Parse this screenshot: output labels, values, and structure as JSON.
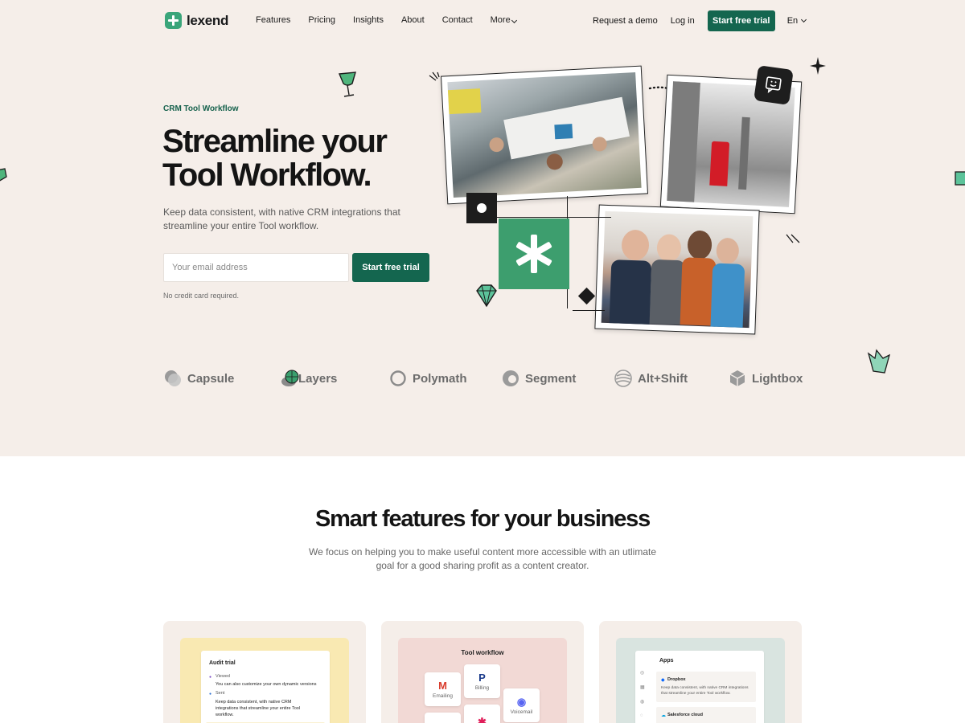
{
  "nav": {
    "logo": "lexend",
    "links": [
      "Features",
      "Pricing",
      "Insights",
      "About",
      "Contact"
    ],
    "more": "More",
    "request_demo": "Request a demo",
    "login": "Log in",
    "cta": "Start free trial",
    "lang": "En"
  },
  "hero": {
    "eyebrow": "CRM Tool Workflow",
    "headline": "Streamline your Tool Workflow.",
    "description": "Keep data consistent, with native CRM integrations that streamline your entire Tool workflow.",
    "email_placeholder": "Your email address",
    "cta": "Start free trial",
    "note": "No credit card required."
  },
  "brands": [
    "Capsule",
    "Layers",
    "Polymath",
    "Segment",
    "Alt+Shift",
    "Lightbox"
  ],
  "features": {
    "title": "Smart features for your business",
    "description": "We focus on helping you to make useful content more accessible with an utlimate goal for a good sharing profit as a content creator."
  },
  "cards": {
    "audit": {
      "title": "Audit trial",
      "items": [
        {
          "tag": "Viewed",
          "text": "You can also customize your own dynamic versions"
        },
        {
          "tag": "Sent",
          "text": "Keep data consistent, with native CRM integrations that streamline your entire Tool workflow."
        }
      ]
    },
    "tool": {
      "title": "Tool workflow",
      "tiles": [
        "Emailing",
        "Billing",
        "Voicemail"
      ]
    },
    "apps": {
      "title": "Apps",
      "items": [
        {
          "name": "Dropbox",
          "text": "Keep data consistent, with native CRM integrations that streamline your entire Tool workflow."
        },
        {
          "name": "Salesforce cloud",
          "text": ""
        }
      ]
    }
  },
  "colors": {
    "brand_green": "#14664f",
    "hero_bg": "#f5eee9",
    "accent_green": "#3d9e6e"
  }
}
